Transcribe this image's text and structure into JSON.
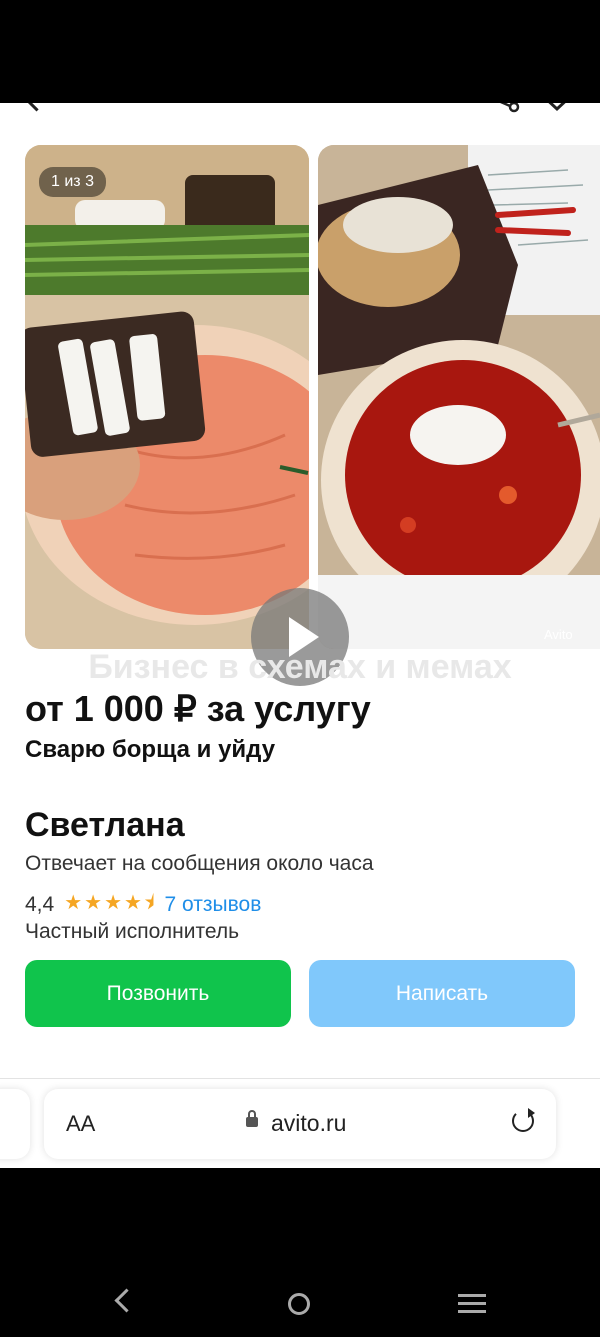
{
  "listing": {
    "photo_counter": "1 из 3",
    "watermark": "Бизнес в схемах и мемах",
    "photo_watermark": "Avito",
    "price": "от 1 000 ₽ за услугу",
    "title": "Сварю борща и уйду"
  },
  "seller": {
    "name": "Светлана",
    "response_time": "Отвечает на сообщения около часа",
    "rating": "4,4",
    "stars": "★★★★⯨",
    "reviews": "7 отзывов",
    "type": "Частный исполнитель"
  },
  "actions": {
    "call_label": "Позвонить",
    "write_label": "Написать"
  },
  "browser": {
    "text_size_label": "AA",
    "url": "avito.ru"
  },
  "colors": {
    "call_button": "#10c44c",
    "write_button": "#80c8fb",
    "link": "#1f8ee8",
    "stars": "#f5a623"
  }
}
